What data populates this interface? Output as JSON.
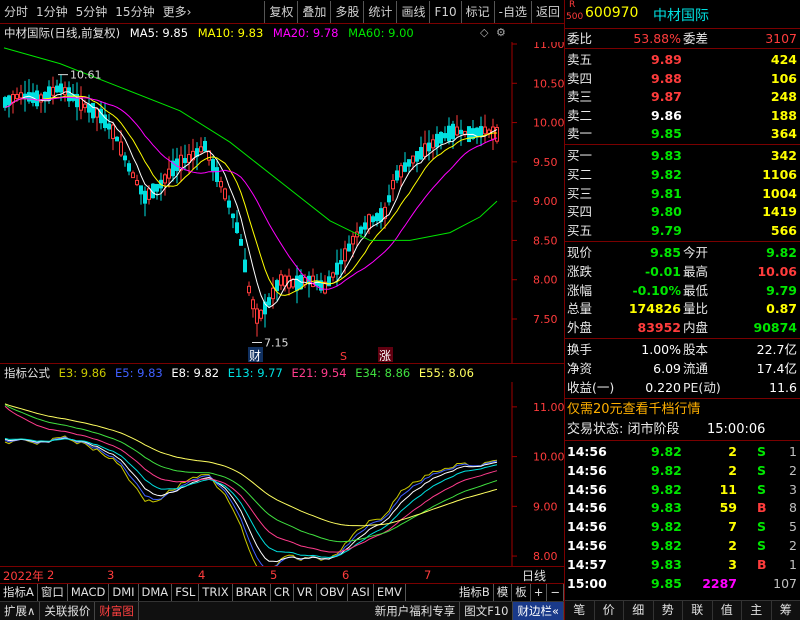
{
  "toolbar": {
    "items": [
      "分时",
      "1分钟",
      "5分钟",
      "15分钟",
      "更多›"
    ],
    "right_items": [
      "复权",
      "叠加",
      "多股",
      "统计",
      "画线",
      "F10",
      "标记",
      "-自选",
      "返回"
    ]
  },
  "main": {
    "title": "中材国际(日线,前复权)",
    "ma5": "MA5: 9.85",
    "ma10": "MA10: 9.83",
    "ma20": "MA20: 9.78",
    "ma60": "MA60: 9.00",
    "high_label": "10.61",
    "low_label": "7.15",
    "marker_cai": "财",
    "marker_s": "S",
    "marker_zhang": "涨",
    "y_ticks": [
      "11.00",
      "10.50",
      "10.00",
      "9.50",
      "9.00",
      "8.50",
      "8.00",
      "7.50"
    ]
  },
  "indicator": {
    "name": "指标公式",
    "e3": "E3: 9.86",
    "e5": "E5: 9.83",
    "e8": "E8: 9.82",
    "e13": "E13: 9.77",
    "e21": "E21: 9.54",
    "e34": "E34: 8.86",
    "e55": "E55: 8.06",
    "y_ticks": [
      "11.00",
      "10.00",
      "9.00",
      "8.00"
    ]
  },
  "xaxis": {
    "labels": [
      "2022年",
      "2",
      "3",
      "4",
      "5",
      "6",
      "7"
    ],
    "period": "日线"
  },
  "ind_tabs": [
    "指标A",
    "窗口",
    "MACD",
    "DMI",
    "DMA",
    "FSL",
    "TRIX",
    "BRAR",
    "CR",
    "VR",
    "OBV",
    "ASI",
    "EMV",
    "指标B",
    "模",
    "板",
    "+",
    "−"
  ],
  "bottom_bar": {
    "left": [
      "扩展∧",
      "关联报价",
      "财富图"
    ],
    "right": [
      "新用户福利专享",
      "图文F10",
      "财边栏«"
    ]
  },
  "quote": {
    "code": "600970",
    "name": "中材国际",
    "badge_r": "R",
    "badge_500": "500",
    "weibi_label": "委比",
    "weibi": "53.88%",
    "weicha_label": "委差",
    "weicha": "3107",
    "sells": [
      {
        "label": "卖五",
        "price": "9.89",
        "vol": "424"
      },
      {
        "label": "卖四",
        "price": "9.88",
        "vol": "106"
      },
      {
        "label": "卖三",
        "price": "9.87",
        "vol": "248"
      },
      {
        "label": "卖二",
        "price": "9.86",
        "vol": "188"
      },
      {
        "label": "卖一",
        "price": "9.85",
        "vol": "364"
      }
    ],
    "buys": [
      {
        "label": "买一",
        "price": "9.83",
        "vol": "342"
      },
      {
        "label": "买二",
        "price": "9.82",
        "vol": "1106"
      },
      {
        "label": "买三",
        "price": "9.81",
        "vol": "1004"
      },
      {
        "label": "买四",
        "price": "9.80",
        "vol": "1419"
      },
      {
        "label": "买五",
        "price": "9.79",
        "vol": "566"
      }
    ],
    "stats": [
      {
        "l1": "现价",
        "v1": "9.85",
        "l2": "今开",
        "v2": "9.82"
      },
      {
        "l1": "涨跌",
        "v1": "-0.01",
        "l2": "最高",
        "v2": "10.06"
      },
      {
        "l1": "涨幅",
        "v1": "-0.10%",
        "l2": "最低",
        "v2": "9.79"
      },
      {
        "l1": "总量",
        "v1": "174826",
        "l2": "量比",
        "v2": "0.87"
      },
      {
        "l1": "外盘",
        "v1": "83952",
        "l2": "内盘",
        "v2": "90874"
      }
    ],
    "fund": [
      {
        "l1": "换手",
        "v1": "1.00%",
        "l2": "股本",
        "v2": "22.7亿"
      },
      {
        "l1": "净资",
        "v1": "6.09",
        "l2": "流通",
        "v2": "17.4亿"
      },
      {
        "l1": "收益(一)",
        "v1": "0.220",
        "l2": "PE(动)",
        "v2": "11.6"
      }
    ],
    "promo": "仅需20元查看千档行情",
    "status_label": "交易状态: 闭市阶段",
    "status_time": "15:00:06",
    "ticks": [
      {
        "t": "14:56",
        "p": "9.82",
        "v": "2",
        "d": "S",
        "n": "1"
      },
      {
        "t": "14:56",
        "p": "9.82",
        "v": "2",
        "d": "S",
        "n": "2"
      },
      {
        "t": "14:56",
        "p": "9.82",
        "v": "11",
        "d": "S",
        "n": "3"
      },
      {
        "t": "14:56",
        "p": "9.83",
        "v": "59",
        "d": "B",
        "n": "8"
      },
      {
        "t": "14:56",
        "p": "9.82",
        "v": "7",
        "d": "S",
        "n": "5"
      },
      {
        "t": "14:56",
        "p": "9.82",
        "v": "2",
        "d": "S",
        "n": "2"
      },
      {
        "t": "14:57",
        "p": "9.83",
        "v": "3",
        "d": "B",
        "n": "1"
      },
      {
        "t": "15:00",
        "p": "9.85",
        "v": "2287",
        "d": "",
        "n": "107"
      }
    ],
    "tabs": [
      "笔",
      "价",
      "细",
      "势",
      "联",
      "值",
      "主",
      "筹"
    ]
  },
  "colors": {
    "up": "#ff3c3c",
    "down": "#00e0e0",
    "ma5": "#ffffff",
    "ma10": "#ffff00",
    "ma20": "#ff00ff",
    "ma60": "#00e600"
  }
}
